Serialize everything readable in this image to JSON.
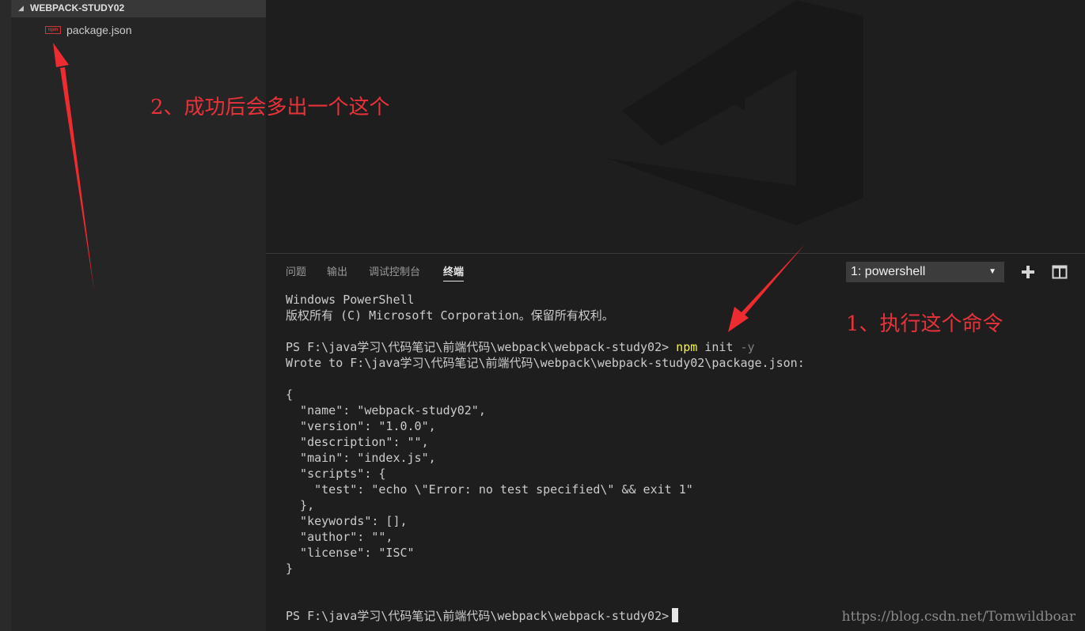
{
  "explorer": {
    "folder_name": "WEBPACK-STUDY02",
    "files": [
      {
        "label": "package.json",
        "icon": "npm-icon",
        "icon_text": "npm"
      }
    ]
  },
  "panel": {
    "tabs": [
      {
        "label": "问题",
        "active": false
      },
      {
        "label": "输出",
        "active": false
      },
      {
        "label": "调试控制台",
        "active": false
      },
      {
        "label": "终端",
        "active": true
      }
    ],
    "terminal_select": "1: powershell",
    "add_icon": "+",
    "split_icon": "split-icon"
  },
  "terminal": {
    "line1": "Windows PowerShell",
    "line2": "版权所有 (C) Microsoft Corporation。保留所有权利。",
    "prompt": "PS F:\\java学习\\代码笔记\\前端代码\\webpack\\webpack-study02> ",
    "cmd_npm": "npm",
    "cmd_init": " init",
    "cmd_flag": " -y",
    "wrote": "Wrote to F:\\java学习\\代码笔记\\前端代码\\webpack\\webpack-study02\\package.json:",
    "json_lines": [
      "{",
      "  \"name\": \"webpack-study02\",",
      "  \"version\": \"1.0.0\",",
      "  \"description\": \"\",",
      "  \"main\": \"index.js\",",
      "  \"scripts\": {",
      "    \"test\": \"echo \\\"Error: no test specified\\\" && exit 1\"",
      "  },",
      "  \"keywords\": [],",
      "  \"author\": \"\",",
      "  \"license\": \"ISC\"",
      "}"
    ],
    "final_prompt": "PS F:\\java学习\\代码笔记\\前端代码\\webpack\\webpack-study02>"
  },
  "annotations": {
    "note1": "1、执行这个命令",
    "note2": "2、成功后会多出一个这个",
    "color": "#e8323a"
  },
  "watermark": "https://blog.csdn.net/Tomwildboar",
  "colors": {
    "npm_keyword": "#f5f543",
    "npm_icon": "#cb3837",
    "annotation": "#e8323a"
  }
}
